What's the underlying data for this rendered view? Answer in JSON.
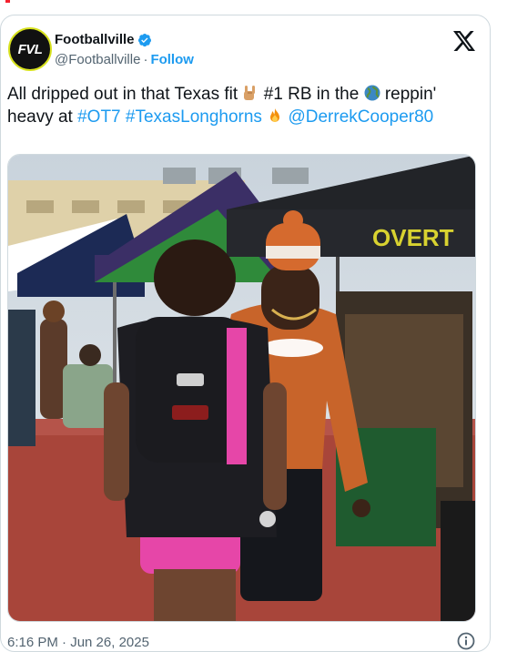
{
  "post": {
    "author_name": "Footballville",
    "handle": "@Footballville",
    "separator": "·",
    "follow_label": "Follow",
    "avatar_text": "FVL",
    "text_part1": "All dripped out in that Texas fit ",
    "text_part2": " #1 RB in the ",
    "text_part3": " reppin'",
    "text_part4": "heavy at ",
    "hashtag1": "#OT7",
    "hashtag2": "#TexasLonghorns",
    "mention": "@DerrekCooper80",
    "sign_text": "OVERT",
    "timestamp": "6:16 PM · Jun 26, 2025"
  },
  "icons": {
    "verified": "verified-badge-icon",
    "close": "x-logo-icon",
    "horns_emoji": "horns-hand-emoji",
    "globe_emoji": "globe-emoji",
    "fire_emoji": "fire-emoji",
    "info": "info-icon"
  },
  "colors": {
    "link": "#1d9bf0",
    "secondary_text": "#536471",
    "primary_text": "#0f1419",
    "border": "#cfd9de",
    "avatar_ring": "#d8e21f",
    "verified": "#1d9bf0"
  }
}
